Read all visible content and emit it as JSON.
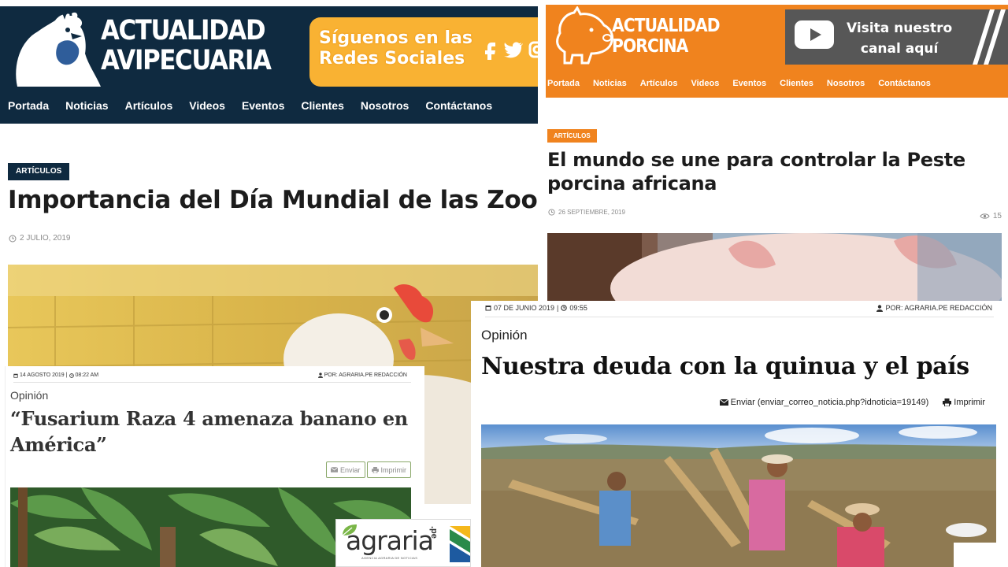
{
  "avipecuaria": {
    "brand_line1": "ACTUALIDAD",
    "brand_line2": "AVIPECUARIA",
    "social_line1": "Síguenos en las",
    "social_line2": "Redes Sociales",
    "social_icons": [
      "facebook-icon",
      "twitter-icon",
      "instagram-icon"
    ],
    "nav": [
      "Portada",
      "Noticias",
      "Artículos",
      "Videos",
      "Eventos",
      "Clientes",
      "Nosotros",
      "Contáctanos"
    ],
    "badge": "ARTÍCULOS",
    "title": "Importancia del Día Mundial de las Zoonosis",
    "date": "2 JULIO, 2019",
    "colors": {
      "header": "#0f2a40",
      "social": "#f9b233"
    }
  },
  "porcina": {
    "brand_line1": "ACTUALIDAD",
    "brand_line2": "PORCINA",
    "youtube_line1": "Visita nuestro",
    "youtube_line2": "canal aquí",
    "nav": [
      "Portada",
      "Noticias",
      "Artículos",
      "Videos",
      "Eventos",
      "Clientes",
      "Nosotros",
      "Contáctanos"
    ],
    "badge": "ARTÍCULOS",
    "title": "El mundo se une para controlar la Peste porcina africana",
    "date": "26 SEPTIEMBRE, 2019",
    "views": "15",
    "colors": {
      "header": "#f0831e",
      "youtube_box": "#575757"
    }
  },
  "quinua": {
    "date": "07 DE JUNIO 2019",
    "time": "09:55",
    "author": "POR: AGRARIA.PE REDACCIÓN",
    "section": "Opinión",
    "title": "Nuestra deuda con la quinua y el país",
    "send_label": "Enviar (enviar_correo_noticia.php?idnoticia=19149)",
    "print_label": "Imprimir"
  },
  "fusarium": {
    "date": "14 AGOSTO 2019",
    "time": "08:22 AM",
    "author": "POR: AGRARIA.PE REDACCIÓN",
    "section": "Opinión",
    "title": "“Fusarium Raza 4 amenaza banano en América”",
    "send_label": "Enviar",
    "print_label": "Imprimir",
    "colors": {
      "button_border": "#8aa86a"
    }
  },
  "agraria_logo": {
    "word": "agraria",
    "suffix": ".pe",
    "tagline": "AGENCIA AGRARIA DE NOTICIAS"
  }
}
